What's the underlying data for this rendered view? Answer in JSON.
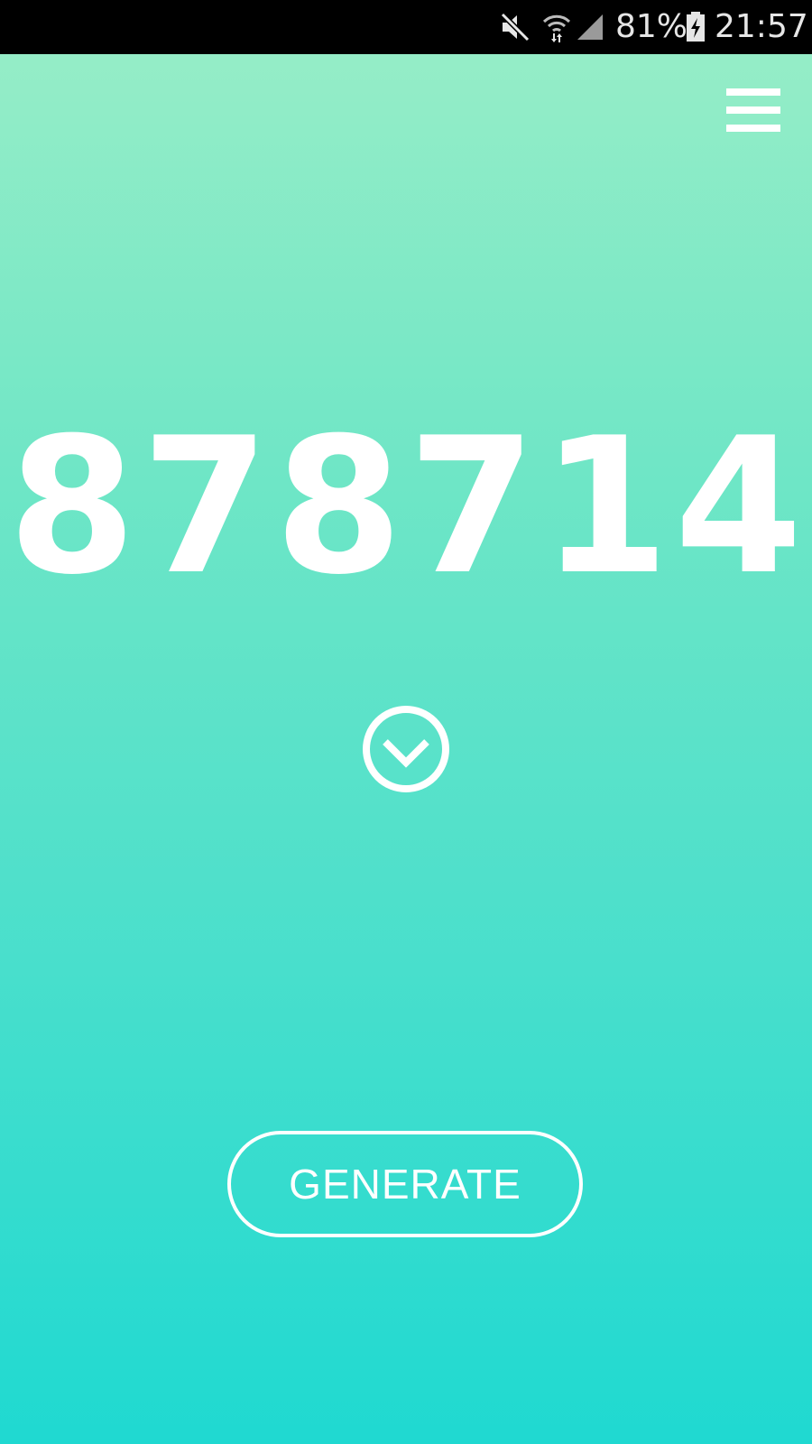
{
  "status_bar": {
    "battery_percent": "81%",
    "time": "21:57",
    "icons": [
      "mute-icon",
      "wifi-icon",
      "cell-signal-icon",
      "battery-charging-icon"
    ]
  },
  "theme": {
    "gradient_top": "#95edc7",
    "gradient_bottom": "#1fd9d1",
    "foreground": "#ffffff"
  },
  "header": {
    "menu_icon": "hamburger-menu-icon"
  },
  "main": {
    "code": "878714",
    "expand_icon": "chevron-down-circle-icon",
    "generate_label": "GENERATE"
  }
}
